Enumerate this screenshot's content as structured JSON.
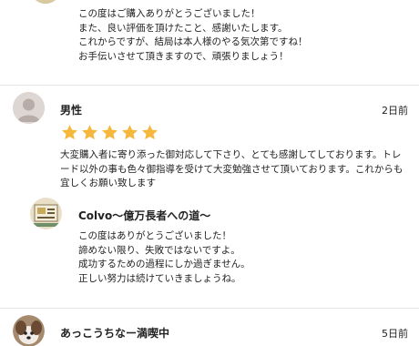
{
  "reply1": {
    "lines": "この度はご購入ありがとうございました！\nまた、良い評価を頂けたこと、感謝いたします。\nこれからですが、結局は本人様のやる気次第ですね！\nお手伝いさせて頂きますので、頑張りましょう！"
  },
  "review2": {
    "name": "男性",
    "date": "2日前",
    "rating": 5,
    "text": "大変購入者に寄り添った御対応して下さり、とても感謝してしております。トレード以外の事も色々御指導を受けて大変勉強させて頂いております。これからも宜しくお願い致します",
    "seller_reply": {
      "name": "Colvo〜億万長者への道〜",
      "text": "この度はありがとうございました！\n諦めない限り、失敗ではないですよ。\n成功するための過程にしか過ぎません。\n正しい努力は続けていきましょうね。"
    }
  },
  "review3": {
    "name": "あっこうちなー満喫中",
    "date": "5日前"
  },
  "colors": {
    "star": "#f5b83d",
    "divider": "#e6e6e6"
  }
}
